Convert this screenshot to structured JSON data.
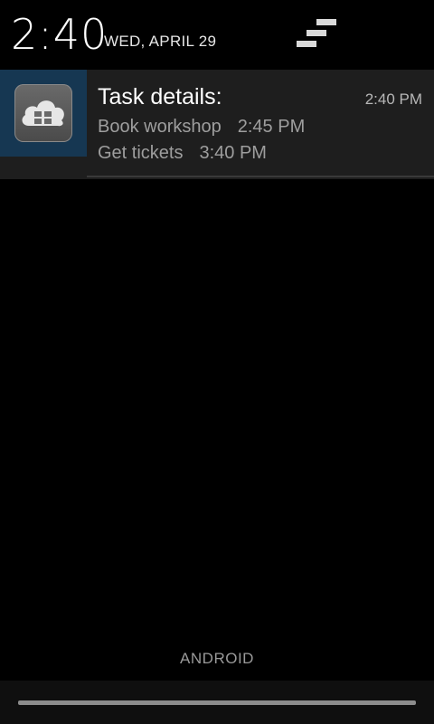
{
  "header": {
    "time": "2:40",
    "date": "WED, APRIL 29"
  },
  "notification": {
    "title": "Task details:",
    "time": "2:40 PM",
    "items": [
      {
        "task": "Book workshop",
        "time": "2:45 PM"
      },
      {
        "task": "Get tickets",
        "time": "3:40 PM"
      }
    ],
    "icon": "cloud-calendar-app-icon"
  },
  "footer": {
    "carrier": "ANDROID"
  },
  "colors": {
    "background": "#000000",
    "notification_bg": "#1e1e1e",
    "icon_bg": "#163752"
  }
}
